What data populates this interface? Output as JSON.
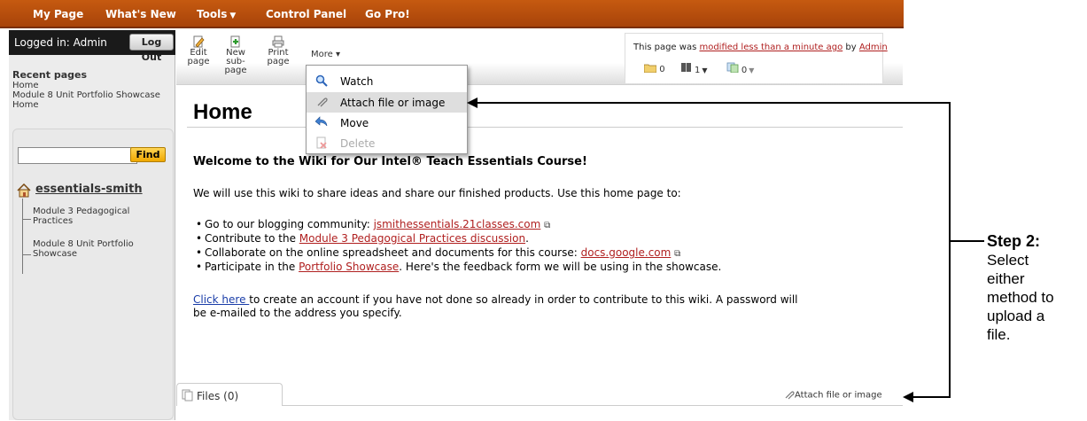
{
  "topnav": {
    "items": [
      {
        "label": "My Page",
        "has_caret": false
      },
      {
        "label": "What's New",
        "has_caret": false
      },
      {
        "label": "Tools",
        "has_caret": true
      },
      {
        "label": "Control Panel",
        "has_caret": false
      },
      {
        "label": "Go Pro!",
        "has_caret": false
      }
    ],
    "color": "#b84d0d"
  },
  "sidebar": {
    "login_text": "Logged in: Admin",
    "logout_label": "Log Out",
    "recent_title": "Recent pages",
    "recent_pages": [
      "Home",
      "Module 8 Unit Portfolio Showcase",
      "Home"
    ],
    "search_placeholder": "",
    "find_label": "Find",
    "wiki_name": "essentials-smith",
    "tree": [
      "Module 3 Pedagogical Practices",
      "Module 8 Unit Portfolio Showcase"
    ]
  },
  "toolbar": {
    "edit_label_1": "Edit",
    "edit_label_2": "page",
    "new_label_1": "New",
    "new_label_2": "sub-page",
    "print_label_1": "Print",
    "print_label_2": "page",
    "more_label": "More ▾"
  },
  "info": {
    "prefix": "This page was ",
    "modified_link": "modified less than a minute ago",
    "by": " by ",
    "user_link": "Admin",
    "folder_count": "0",
    "book_count": "1",
    "pages_count": "0"
  },
  "menu": {
    "items": [
      {
        "label": "Watch",
        "icon": "magnifier-icon",
        "disabled": false,
        "highlighted": false
      },
      {
        "label": "Attach file or image",
        "icon": "paperclip-icon",
        "disabled": false,
        "highlighted": true
      },
      {
        "label": "Move",
        "icon": "move-arrow-icon",
        "disabled": false,
        "highlighted": false
      },
      {
        "label": "Delete",
        "icon": "delete-icon",
        "disabled": true,
        "highlighted": false
      }
    ]
  },
  "content": {
    "title": "Home",
    "welcome": "Welcome to the Wiki for Our Intel® Teach Essentials Course!",
    "intro": "We will use this wiki to share ideas and share our finished products. Use this home page to:",
    "bullets": [
      {
        "pre": "Go to our blogging community: ",
        "link": "jsmithessentials.21classes.com",
        "post": "",
        "external": true
      },
      {
        "pre": "Contribute to the ",
        "link": "Module 3 Pedagogical Practices discussion",
        "post": ".",
        "external": false
      },
      {
        "pre": "Collaborate on the online spreadsheet and documents for this course: ",
        "link": "docs.google.com",
        "post": "",
        "external": true
      },
      {
        "pre": "Participate in the ",
        "link": "Portfolio Showcase",
        "post": ". Here's the feedback form we will be using in the showcase.",
        "external": false
      }
    ],
    "click_here_link": "Click here ",
    "click_here_rest_1": "to create an account if you have not done so already in order to contribute to this wiki. A password will",
    "click_here_rest_2": "be e-mailed to the address you specify."
  },
  "files": {
    "tab_label": "Files (0)",
    "attach_label": "Attach file or image"
  },
  "annotation": {
    "step_title": "Step 2:",
    "step_lines": [
      "Select",
      "either",
      "method to",
      "upload a",
      "file."
    ]
  }
}
